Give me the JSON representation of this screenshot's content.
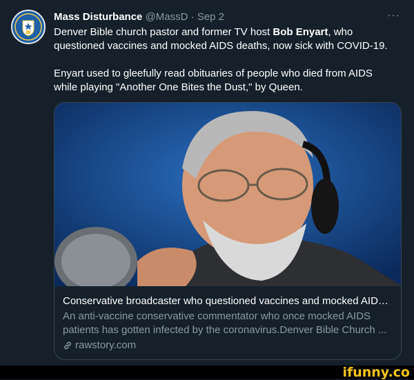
{
  "tweet": {
    "author_name": "Mass Disturbance",
    "handle": "@MassD",
    "separator": "·",
    "date": "Sep 2",
    "more_label": "···",
    "para1_start": "Denver Bible church pastor and former TV host ",
    "para1_bold": "Bob Enyart",
    "para1_end": ", who questioned vaccines and mocked AIDS deaths, now sick with COVID-19.",
    "para2": "Enyart used to gleefully read obituaries of people who died from AIDS while playing \"Another One Bites the Dust,\" by Queen."
  },
  "card": {
    "title": "Conservative broadcaster who questioned vaccines and mocked AIDS...",
    "description": "An anti-vaccine conservative commentator who once mocked AIDS patients has gotten infected by the coronavirus.Denver Bible Church ...",
    "domain": "rawstory.com",
    "domain_icon": "link-icon"
  },
  "watermark": "ifunny.co",
  "colors": {
    "background": "#15202b",
    "secondary_text": "#8b98a5",
    "border": "#38444d",
    "watermark": "#f5c518"
  }
}
